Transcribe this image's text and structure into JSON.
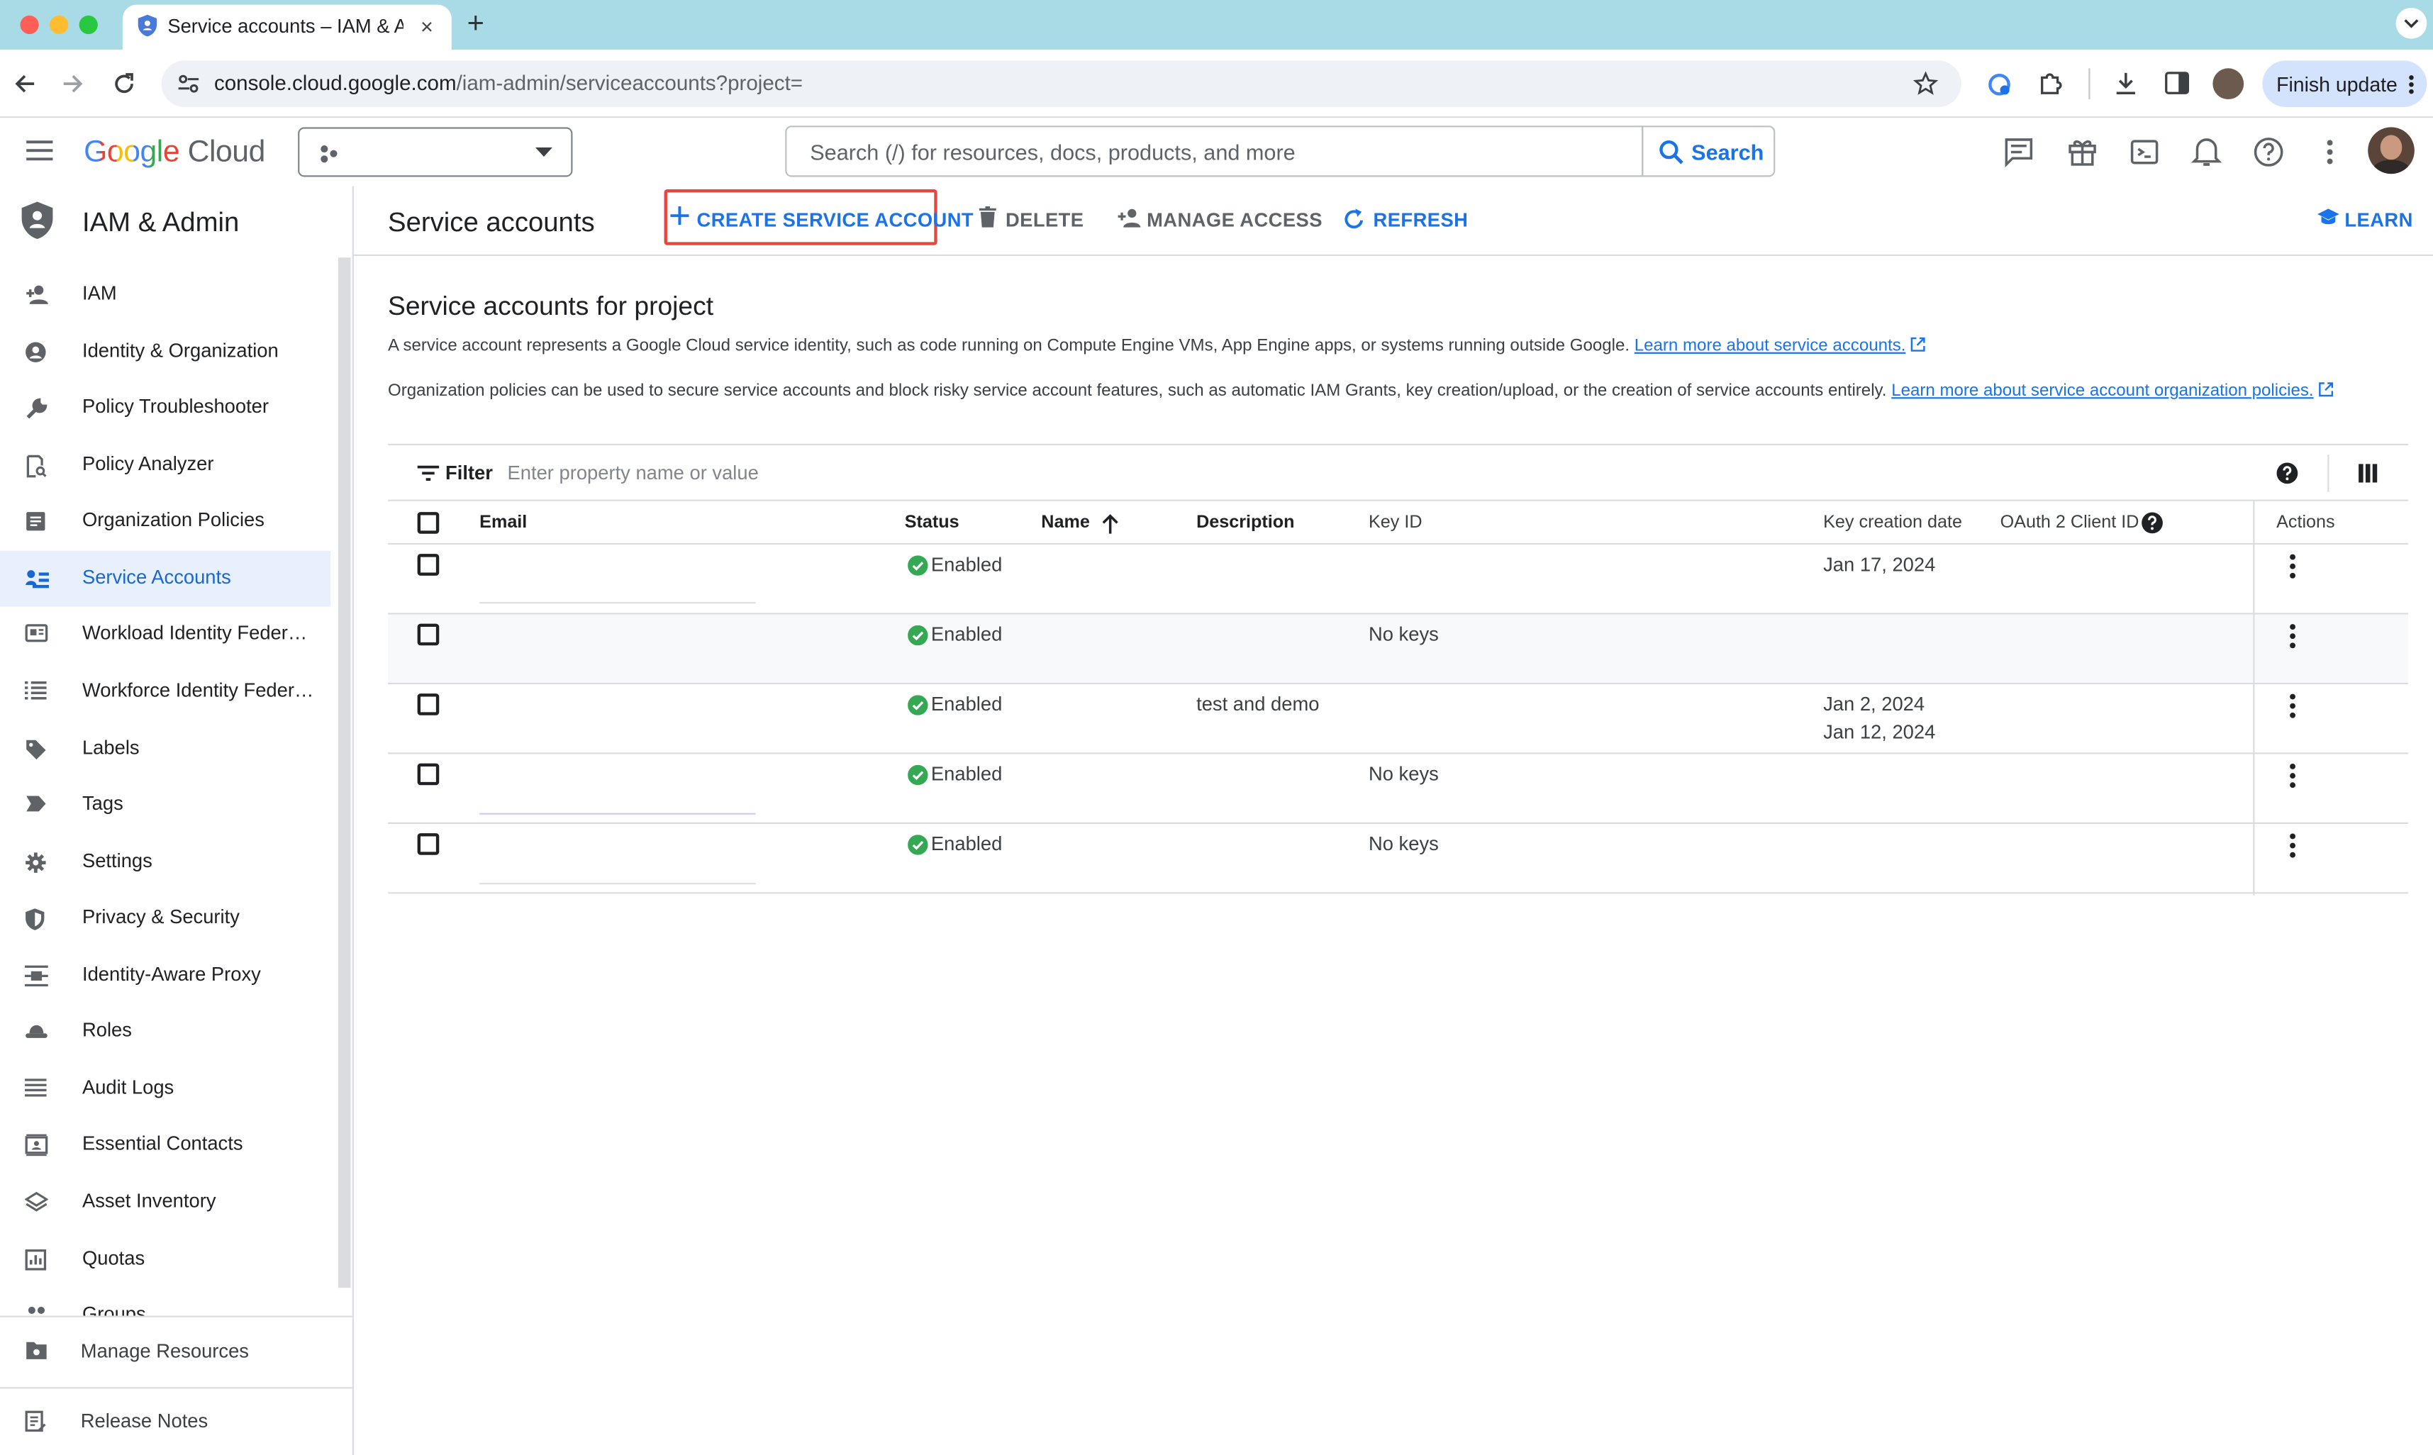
{
  "browser": {
    "tab_title": "Service accounts – IAM & Admin",
    "tab_close": "×",
    "new_tab": "+",
    "url_domain": "console.cloud.google.com",
    "url_path": "/iam-admin/serviceaccounts?project=",
    "finish_update": "Finish update"
  },
  "header": {
    "logo_google": "Google",
    "logo_cloud": "Cloud",
    "search_placeholder": "Search (/) for resources, docs, products, and more",
    "search_button": "Search"
  },
  "sidebar": {
    "title": "IAM & Admin",
    "items": [
      {
        "label": "IAM",
        "icon": "person-add-icon"
      },
      {
        "label": "Identity & Organization",
        "icon": "account-circle-icon"
      },
      {
        "label": "Policy Troubleshooter",
        "icon": "wrench-icon"
      },
      {
        "label": "Policy Analyzer",
        "icon": "document-search-icon"
      },
      {
        "label": "Organization Policies",
        "icon": "list-document-icon"
      },
      {
        "label": "Service Accounts",
        "icon": "service-account-icon"
      },
      {
        "label": "Workload Identity Federat...",
        "icon": "id-card-icon"
      },
      {
        "label": "Workforce Identity Federa...",
        "icon": "list-icon"
      },
      {
        "label": "Labels",
        "icon": "label-icon"
      },
      {
        "label": "Tags",
        "icon": "tag-icon"
      },
      {
        "label": "Settings",
        "icon": "gear-icon"
      },
      {
        "label": "Privacy & Security",
        "icon": "shield-icon"
      },
      {
        "label": "Identity-Aware Proxy",
        "icon": "proxy-icon"
      },
      {
        "label": "Roles",
        "icon": "hat-icon"
      },
      {
        "label": "Audit Logs",
        "icon": "lines-icon"
      },
      {
        "label": "Essential Contacts",
        "icon": "contacts-icon"
      },
      {
        "label": "Asset Inventory",
        "icon": "diamond-stack-icon"
      },
      {
        "label": "Quotas",
        "icon": "quota-icon"
      },
      {
        "label": "Groups",
        "icon": "groups-icon"
      }
    ],
    "bottom": [
      {
        "label": "Manage Resources",
        "icon": "folder-gear-icon"
      },
      {
        "label": "Release Notes",
        "icon": "notes-icon"
      }
    ]
  },
  "toolbar": {
    "title": "Service accounts",
    "create": "CREATE SERVICE ACCOUNT",
    "delete": "DELETE",
    "manage_access": "MANAGE ACCESS",
    "refresh": "REFRESH",
    "learn": "LEARN"
  },
  "content": {
    "heading": "Service accounts for project",
    "para1": "A service account represents a Google Cloud service identity, such as code running on Compute Engine VMs, App Engine apps, or systems running outside Google.",
    "para1_link": "Learn more about service accounts.",
    "para2": "Organization policies can be used to secure service accounts and block risky service account features, such as automatic IAM Grants, key creation/upload, or the creation of service accounts entirely.",
    "para2_link": "Learn more about service account organization policies.",
    "filter_label": "Filter",
    "filter_placeholder": "Enter property name or value"
  },
  "table": {
    "headers": {
      "email": "Email",
      "status": "Status",
      "name": "Name",
      "description": "Description",
      "key_id": "Key ID",
      "key_creation_date": "Key creation date",
      "oauth": "OAuth 2 Client ID",
      "actions": "Actions"
    },
    "rows": [
      {
        "status": "Enabled",
        "description": "",
        "key_id": "",
        "date1": "Jan 17, 2024",
        "date2": ""
      },
      {
        "status": "Enabled",
        "description": "",
        "key_id": "No keys",
        "date1": "",
        "date2": ""
      },
      {
        "status": "Enabled",
        "description": "test and demo",
        "key_id": "",
        "date1": "Jan 2, 2024",
        "date2": "Jan 12, 2024"
      },
      {
        "status": "Enabled",
        "description": "",
        "key_id": "No keys",
        "date1": "",
        "date2": ""
      },
      {
        "status": "Enabled",
        "description": "",
        "key_id": "No keys",
        "date1": "",
        "date2": ""
      }
    ]
  },
  "colors": {
    "accent": "#1a73e8",
    "status_green": "#34a853",
    "highlight_box": "#e8453c",
    "tab_bar": "#a9dbe6"
  }
}
